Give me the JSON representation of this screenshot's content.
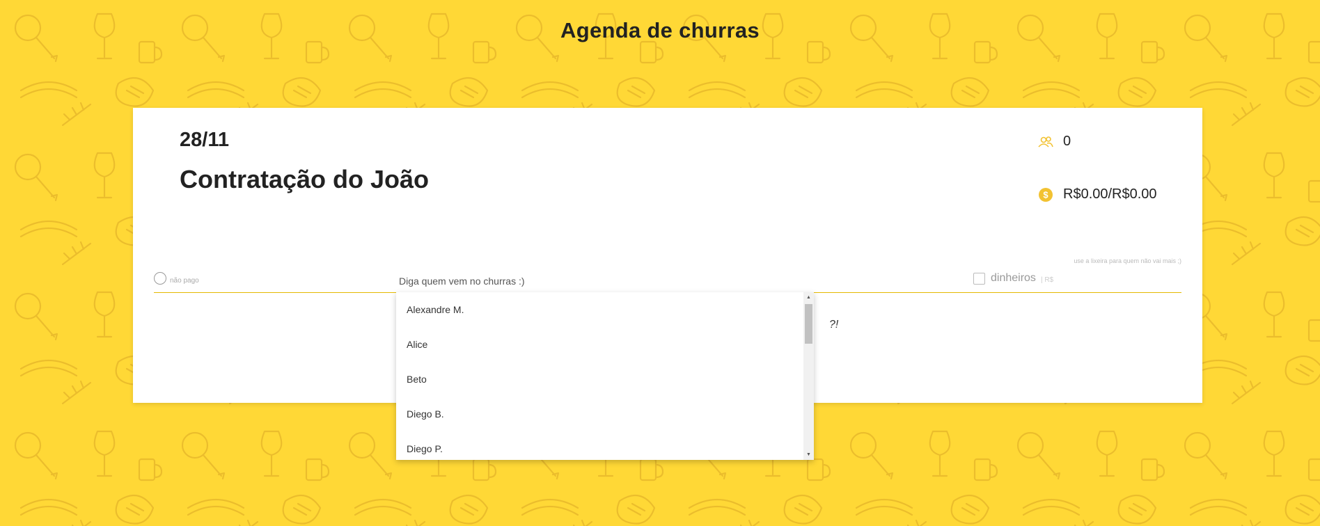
{
  "app": {
    "title": "Agenda de churras"
  },
  "event": {
    "date": "28/11",
    "name": "Contratação do João",
    "people_count": "0",
    "money": "R$0.00/R$0.00"
  },
  "add_form": {
    "paid_label": "não pago",
    "name_placeholder": "Diga quem vem no churras :)",
    "money_label": "dinheiros",
    "money_unit": "| R$",
    "helper_text": "use a lixeira para quem não vai mais ;)"
  },
  "empty_hint": "?!",
  "dropdown": {
    "options": [
      "Alexandre M.",
      "Alice",
      "Beto",
      "Diego B.",
      "Diego P."
    ]
  },
  "icons": {
    "people": "people-icon",
    "money": "dollar-coin-icon"
  },
  "colors": {
    "background": "#FFD836",
    "accent": "#FFD836",
    "card": "#FFFFFF"
  }
}
